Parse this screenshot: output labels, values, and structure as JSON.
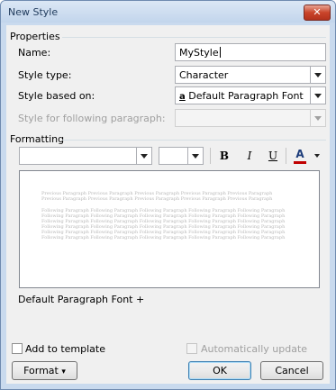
{
  "window": {
    "title": "New Style",
    "close_glyph": "✕"
  },
  "properties": {
    "group_label": "Properties",
    "name_label": "Name:",
    "name_value": "MyStyle",
    "style_type_label": "Style type:",
    "style_type_value": "Character",
    "based_on_label": "Style based on:",
    "based_on_icon": "a",
    "based_on_value": "Default Paragraph Font",
    "following_label": "Style for following paragraph:",
    "following_value": ""
  },
  "formatting": {
    "group_label": "Formatting",
    "font_value": "",
    "size_value": "",
    "bold": "B",
    "italic": "I",
    "underline": "U",
    "font_color_letter": "A",
    "font_color": "#c00000",
    "icons": [
      "bold-icon",
      "italic-icon",
      "underline-icon",
      "font-color-icon",
      "align-left-icon",
      "align-center-icon",
      "align-right-icon",
      "justify-icon",
      "single-spacing-icon",
      "one-half-spacing-icon",
      "double-spacing-icon",
      "increase-paragraph-spacing-icon",
      "decrease-paragraph-spacing-icon",
      "decrease-indent-icon",
      "increase-indent-icon"
    ]
  },
  "preview": {
    "previous_lines": [
      "Previous Paragraph Previous Paragraph Previous Paragraph Previous Paragraph Previous Paragraph",
      "Previous Paragraph Previous Paragraph Previous Paragraph Previous Paragraph Previous Paragraph"
    ],
    "following_lines": [
      "Following Paragraph Following Paragraph Following Paragraph Following Paragraph Following Paragraph",
      "Following Paragraph Following Paragraph Following Paragraph Following Paragraph Following Paragraph",
      "Following Paragraph Following Paragraph Following Paragraph Following Paragraph Following Paragraph",
      "Following Paragraph Following Paragraph Following Paragraph Following Paragraph Following Paragraph",
      "Following Paragraph Following Paragraph Following Paragraph Following Paragraph Following Paragraph",
      "Following Paragraph Following Paragraph Following Paragraph Following Paragraph Following Paragraph"
    ]
  },
  "description": "Default Paragraph Font +",
  "options": {
    "add_to_template": "Add to template",
    "add_to_template_checked": false,
    "auto_update": "Automatically update",
    "auto_update_checked": false
  },
  "buttons": {
    "format": "Format",
    "format_arrow": "▾",
    "ok": "OK",
    "cancel": "Cancel"
  }
}
